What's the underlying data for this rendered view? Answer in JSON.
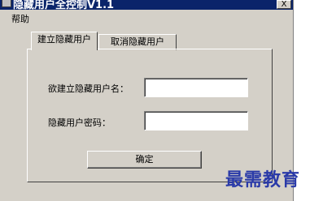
{
  "window": {
    "title": "隐藏用户全控制V1.1",
    "close_label": "X"
  },
  "menu": {
    "items": [
      "帮助"
    ]
  },
  "tabs": [
    {
      "label": "建立隐藏用户",
      "active": true
    },
    {
      "label": "取消隐藏用户",
      "active": false
    }
  ],
  "form": {
    "username_label": "欲建立隐藏用户名：",
    "username_value": "",
    "password_label": "隐藏用户密码：",
    "password_value": "",
    "confirm_label": "确定"
  },
  "watermark": {
    "text": "最需教育"
  }
}
